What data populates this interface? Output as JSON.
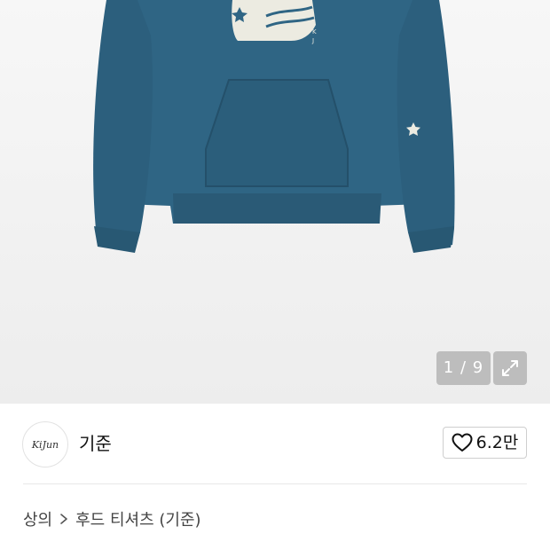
{
  "gallery": {
    "image_alt": "Blue hoodie",
    "counter": "1 / 9",
    "expand_icon": "expand-arrows-icon"
  },
  "brand": {
    "logo_text": "KiJun",
    "name": "기준"
  },
  "like": {
    "icon": "heart-outline-icon",
    "count": "6.2만"
  },
  "breadcrumb": {
    "items": [
      "상의",
      "후드 티셔츠 (기준)"
    ],
    "separator_icon": "chevron-right-icon"
  },
  "colors": {
    "hoodie": "#2f6584",
    "hoodie_shadow": "#275671",
    "graphic": "#ecebe1",
    "background": "#f2f2f2"
  }
}
